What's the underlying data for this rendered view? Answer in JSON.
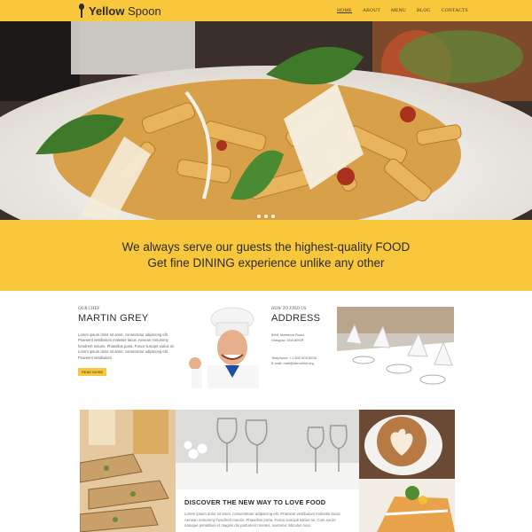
{
  "header": {
    "logo_bold": "Yellow",
    "logo_light": "Spoon",
    "logo_icon": "spoon-icon",
    "nav": [
      {
        "label": "HOME",
        "active": true
      },
      {
        "label": "ABOUT",
        "active": false
      },
      {
        "label": "MENU",
        "active": false
      },
      {
        "label": "BLOG",
        "active": false
      },
      {
        "label": "CONTACTS",
        "active": false
      }
    ]
  },
  "hero": {
    "slide_count": 3
  },
  "tagline": {
    "line1": "We always serve our guests the highest-quality FOOD",
    "line2": "Get fine DINING experience unlike any other"
  },
  "chef": {
    "label": "OUR CHEF",
    "name": "MARTIN GREY",
    "text": "Lorem ipsum dolor sit amet, consectetur adipiscing elit. Praesent vestibulum molestie lacus. Aenean nonummy hendrerit mauris. Phasellus porta. Fusce suscipit varius mi. Lorem ipsum dolor sit amet, consectetur adipiscing elit. Praesent vestibulum",
    "button": "READ MORE"
  },
  "address": {
    "label": "HOW TO FIND US",
    "title": "ADDRESS",
    "street": "8901 Marmora Road,",
    "city": "Glasgow, D04 89GR",
    "phone": "Telephone:   +1 800 603 6035",
    "email": "E-mail: mail@demolink.org"
  },
  "feature": {
    "title": "DISCOVER THE NEW WAY TO LOVE FOOD",
    "text": "Lorem ipsum dolor sit amet, consectetuer adipiscing elit. Praesent vestibulum molestie lacus. Aenean nonummy hendrerit mauris. Phasellus porta. Fusce suscipit varius mi. Cum sociis natoque penatibus et magnis dis parturient montes, nascetur ridiculus mus."
  },
  "colors": {
    "brand_yellow": "#f9c73b",
    "text_dark": "#2b2b2b"
  }
}
